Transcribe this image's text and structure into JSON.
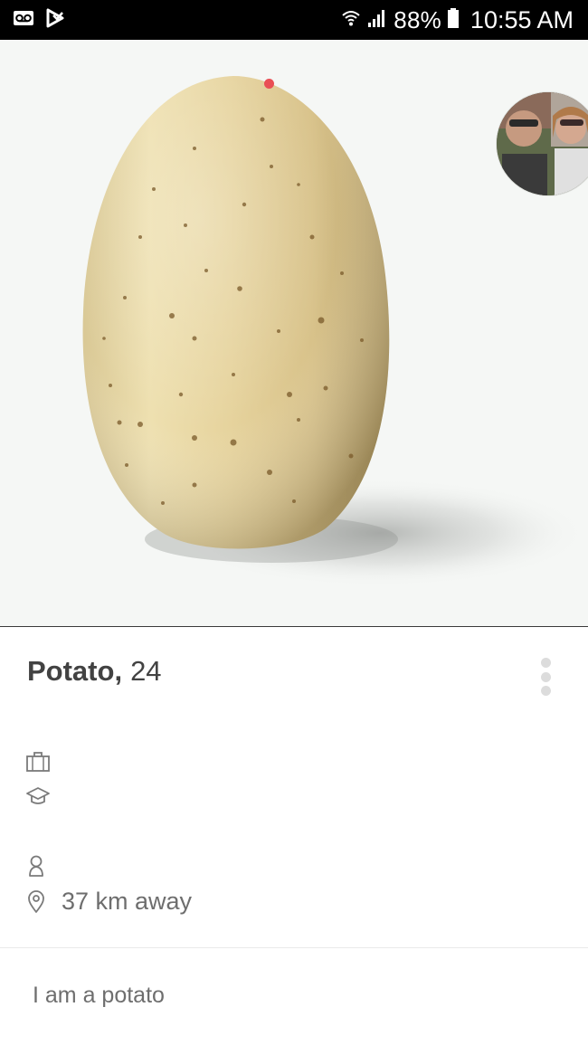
{
  "status_bar": {
    "left_icons": [
      "voicemail-icon",
      "missed-call-icon"
    ],
    "battery_percent": "88%",
    "time": "10:55 AM",
    "right_icons": [
      "wifi-icon",
      "signal-icon",
      "battery-icon"
    ]
  },
  "photo": {
    "subject": "potato",
    "page_indicator_color": "#e94f55"
  },
  "profile": {
    "name": "Potato",
    "comma": ",",
    "age": "24",
    "job_icon": "briefcase-icon",
    "school_icon": "graduation-cap-icon",
    "gender_icon": "person-icon",
    "distance_icon": "location-pin-icon",
    "distance": "37 km away",
    "bio": "I am a potato"
  },
  "colors": {
    "accent": "#e94f55",
    "text_primary": "#424242",
    "text_secondary": "#6e6e6e"
  }
}
